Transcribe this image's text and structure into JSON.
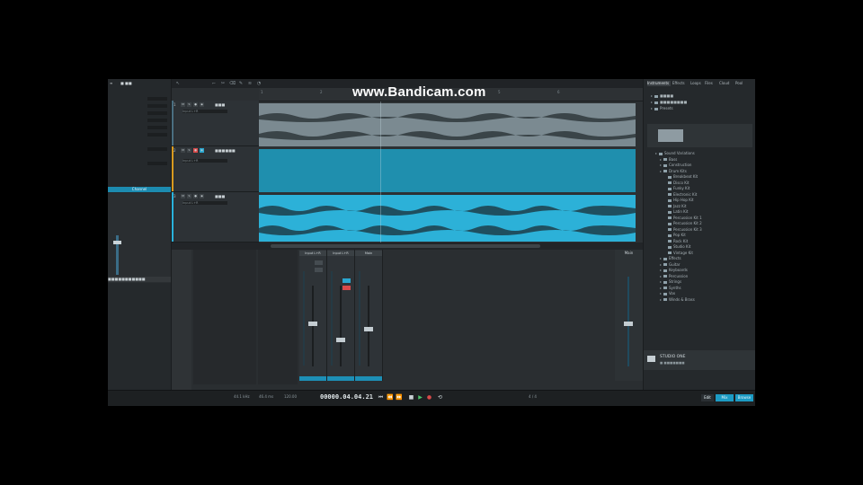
{
  "watermark": "www.Bandicam.com",
  "accent": "#1c9bc4",
  "inspector": {
    "tabs": [
      "≡",
      "■ ■■"
    ],
    "channel_label": "Channel",
    "footer": "■■■■■■■■■■■"
  },
  "arrange": {
    "ruler_marks": [
      "1",
      "2",
      "3",
      "4",
      "5",
      "6"
    ],
    "tracks": [
      {
        "number": "1",
        "name": "■■■",
        "io": "Input L+R",
        "color": "#4a6e80",
        "clip_color": "#7b8a91"
      },
      {
        "number": "2",
        "name": "■■■■■■",
        "io": "Input L+R",
        "color": "#d89a1f",
        "clip_color": "#1f8fae"
      },
      {
        "number": "3",
        "name": "■■■",
        "io": "Input L+R",
        "color": "#29b3dc",
        "clip_color": "#2cb1d8"
      }
    ]
  },
  "browser": {
    "tabs": [
      "Instruments",
      "Effects",
      "Loops",
      "Files",
      "Cloud",
      "Pool"
    ],
    "tree": [
      {
        "label": "■■■■",
        "depth": 0
      },
      {
        "label": "■■■■■■■■",
        "depth": 0
      },
      {
        "label": "Presets",
        "depth": 0
      },
      {
        "label": "Sound Variations",
        "depth": 1
      },
      {
        "label": "Bass",
        "depth": 2
      },
      {
        "label": "Construction",
        "depth": 2
      },
      {
        "label": "Drum Kits",
        "depth": 2
      },
      {
        "label": "Breakbeat Kit",
        "depth": 3
      },
      {
        "label": "Disco Kit",
        "depth": 3
      },
      {
        "label": "Funky Kit",
        "depth": 3
      },
      {
        "label": "Electronic Kit",
        "depth": 3
      },
      {
        "label": "Hip Hop Kit",
        "depth": 3
      },
      {
        "label": "Jazz Kit",
        "depth": 3
      },
      {
        "label": "Latin Kit",
        "depth": 3
      },
      {
        "label": "Percussion Kit 1",
        "depth": 3
      },
      {
        "label": "Percussion Kit 2",
        "depth": 3
      },
      {
        "label": "Percussion Kit 3",
        "depth": 3
      },
      {
        "label": "Pop Kit",
        "depth": 3
      },
      {
        "label": "Rock Kit",
        "depth": 3
      },
      {
        "label": "Studio Kit",
        "depth": 3
      },
      {
        "label": "Vintage Kit",
        "depth": 3
      },
      {
        "label": "Effects",
        "depth": 2
      },
      {
        "label": "Guitar",
        "depth": 2
      },
      {
        "label": "Keyboards",
        "depth": 2
      },
      {
        "label": "Percussion",
        "depth": 2
      },
      {
        "label": "Strings",
        "depth": 2
      },
      {
        "label": "Synths",
        "depth": 2
      },
      {
        "label": "Vox",
        "depth": 2
      },
      {
        "label": "Winds & Brass",
        "depth": 2
      }
    ],
    "footer_title": "STUDIO ONE",
    "footer_sub": "■ ■■■■■■■"
  },
  "console": {
    "channels": [
      {
        "name": "Input L+R",
        "fader": 0.55,
        "rec": false
      },
      {
        "name": "Input L+R",
        "fader": 0.35,
        "rec": true
      },
      {
        "name": "Main",
        "fader": 0.5,
        "rec": false
      }
    ],
    "main_label": "Main"
  },
  "transport": {
    "timecode": "00000.04.04.21",
    "sample_rate": "44.1 kHz",
    "latency": "46.4 ms",
    "tempo": "120.00",
    "signature": "4 / 4",
    "buttons": [
      "Edit",
      "Mix",
      "Browse"
    ]
  }
}
